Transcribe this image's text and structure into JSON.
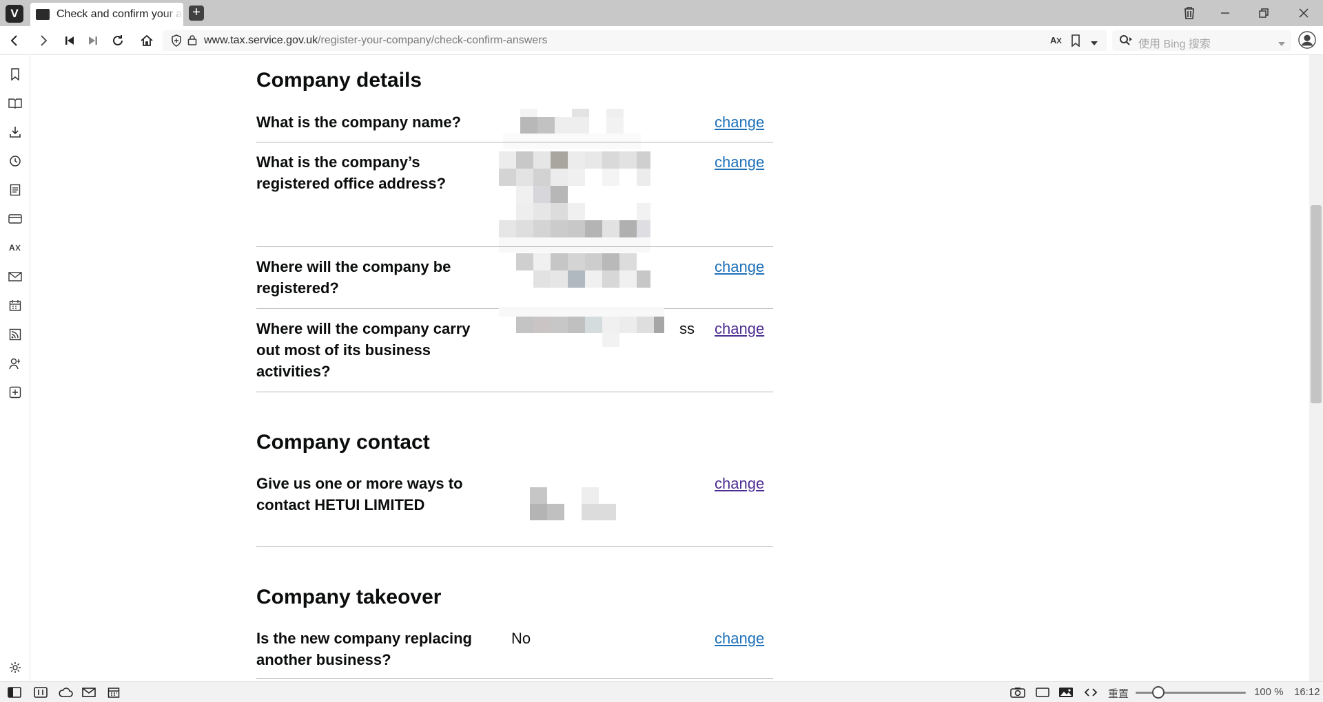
{
  "browser": {
    "tab_title": "Check and confirm your answers",
    "url_host": "www.tax.service.gov.uk",
    "url_path": "/register-your-company/check-confirm-answers",
    "search_placeholder": "使用 Bing 搜索"
  },
  "icons": {
    "logo": "vivaldi-logo-icon",
    "new_tab": "plus-icon",
    "trash": "trash-icon",
    "minimize": "minimize-icon",
    "restore": "restore-icon",
    "close": "close-icon",
    "back": "back-icon",
    "forward": "forward-icon",
    "rewind": "rewind-icon",
    "fast_forward": "fast-forward-icon",
    "reload": "reload-icon",
    "home": "home-icon",
    "shield": "shield-icon",
    "lock": "lock-icon",
    "translate": "translate-icon",
    "bookmark": "bookmark-icon",
    "profile": "profile-icon"
  },
  "sidebar": {
    "items": [
      "bookmarks-icon",
      "reading-list-icon",
      "downloads-icon",
      "history-icon",
      "notes-icon",
      "window-panel-icon",
      "translate-panel-icon",
      "mail-icon",
      "calendar-icon",
      "feeds-icon",
      "contacts-icon",
      "add-panel-icon",
      "settings-icon"
    ]
  },
  "page": {
    "sections": {
      "details": {
        "title": "Company details"
      },
      "contact": {
        "title": "Company contact"
      },
      "takeover": {
        "title": "Company takeover"
      }
    },
    "rows": {
      "name": {
        "q": "What is the company name?",
        "change": "change"
      },
      "address": {
        "q1": "What is the company’s",
        "q2": "registered office address?",
        "change": "change"
      },
      "registered": {
        "q1": "Where will the company be",
        "q2": "registered?",
        "change": "change"
      },
      "activities": {
        "q1": "Where will the company carry",
        "q2": "out most of its business",
        "q3": "activities?",
        "answer_suffix": "ss",
        "change": "change"
      },
      "contact": {
        "q1": "Give us one or more ways to",
        "q2": "contact HETUI LIMITED",
        "change": "change"
      },
      "replacing": {
        "q1": "Is the new company replacing",
        "q2": "another business?",
        "answer": "No",
        "change": "change"
      }
    }
  },
  "status": {
    "reset_label": "重置",
    "zoom": "100 %",
    "clock": "16:12"
  }
}
